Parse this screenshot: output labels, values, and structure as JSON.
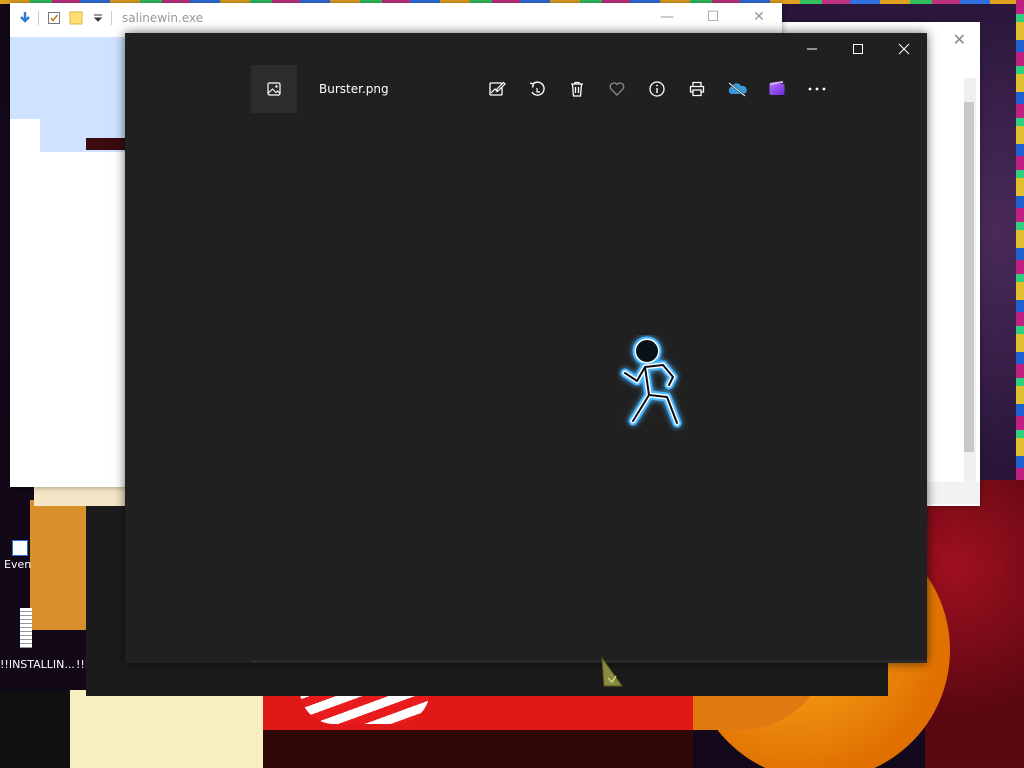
{
  "explorer": {
    "title": "salinewin.exe",
    "minimize": "—",
    "maximize": "☐",
    "close": "✕"
  },
  "behind_window": {
    "close": "✕"
  },
  "desktop": {
    "icons": [
      {
        "name": "desktop-icon-event",
        "label": "Even"
      },
      {
        "name": "desktop-icon-installing-1",
        "label": "!!INSTALLIN..."
      },
      {
        "name": "desktop-icon-installing-2",
        "label": "!!I"
      }
    ]
  },
  "photos": {
    "filename": "Burster.png",
    "actions": [
      {
        "name": "edit-create-icon",
        "label": "Edit & Create"
      },
      {
        "name": "rotate-icon",
        "label": "Rotate"
      },
      {
        "name": "delete-icon",
        "label": "Delete"
      },
      {
        "name": "favorite-icon",
        "label": "Add to favorites"
      },
      {
        "name": "info-icon",
        "label": "File info"
      },
      {
        "name": "print-icon",
        "label": "Print"
      },
      {
        "name": "onedrive-icon",
        "label": "OneDrive"
      },
      {
        "name": "clipchamp-icon",
        "label": "Clipchamp"
      },
      {
        "name": "more-icon",
        "label": "See more"
      }
    ],
    "colors": {
      "background": "#202020",
      "figure_glow": "#49b6ff"
    }
  }
}
